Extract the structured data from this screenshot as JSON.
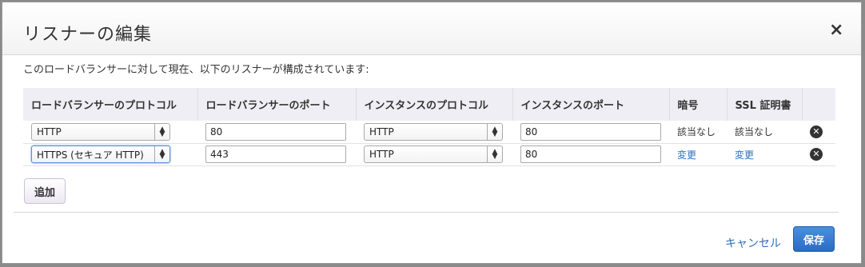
{
  "dialog": {
    "title": "リスナーの編集",
    "close_symbol": "×",
    "description": "このロードバランサーに対して現在、以下のリスナーが構成されています:"
  },
  "table": {
    "headers": [
      "ロードバランサーのプロトコル",
      "ロードバランサーのポート",
      "インスタンスのプロトコル",
      "インスタンスのポート",
      "暗号",
      "SSL 証明書",
      ""
    ],
    "rows": [
      {
        "lb_protocol": "HTTP",
        "lb_port": "80",
        "instance_protocol": "HTTP",
        "instance_port": "80",
        "cipher": "該当なし",
        "ssl_cert": "該当なし",
        "cipher_is_link": false
      },
      {
        "lb_protocol": "HTTPS (セキュア HTTP)",
        "lb_port": "443",
        "instance_protocol": "HTTP",
        "instance_port": "80",
        "cipher": "変更",
        "ssl_cert": "変更",
        "cipher_is_link": true
      }
    ]
  },
  "buttons": {
    "add": "追加",
    "cancel": "キャンセル",
    "save": "保存"
  },
  "colors": {
    "link": "#2b6fbf",
    "primary": "#2a6cc0",
    "header_bg": "#f0eef5"
  },
  "icons": {
    "close": "close-icon",
    "remove": "remove-circle-icon",
    "select_arrows": "chevron-updown-icon"
  }
}
